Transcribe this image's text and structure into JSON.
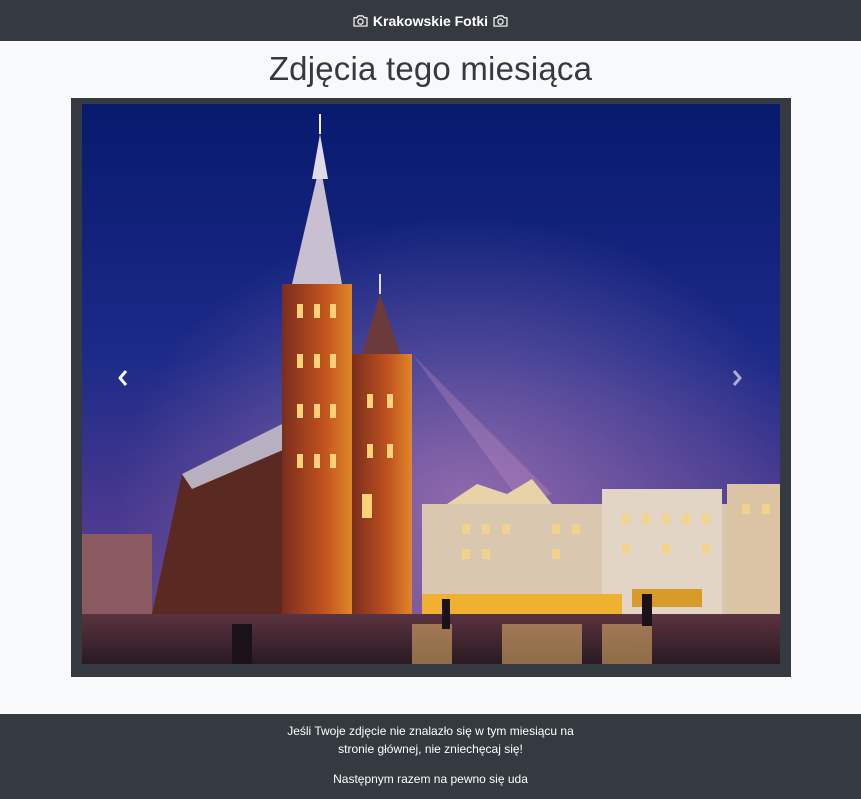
{
  "header": {
    "brand": "Krakowskie Fotki",
    "icon": "camera-icon"
  },
  "main": {
    "title": "Zdjęcia tego miesiąca"
  },
  "carousel": {
    "prev_icon": "chevron-left-icon",
    "next_icon": "chevron-right-icon",
    "accent_colors": {
      "sky_top": "#071a6e",
      "sky_bottom": "#5a3f8f",
      "frame": "#343a40"
    }
  },
  "footer": {
    "message": "Jeśli Twoje zdjęcie nie znalazło się w tym miesiącu na stronie głównej, nie zniechęcaj się!",
    "cta": "Następnym razem na pewno się uda"
  }
}
